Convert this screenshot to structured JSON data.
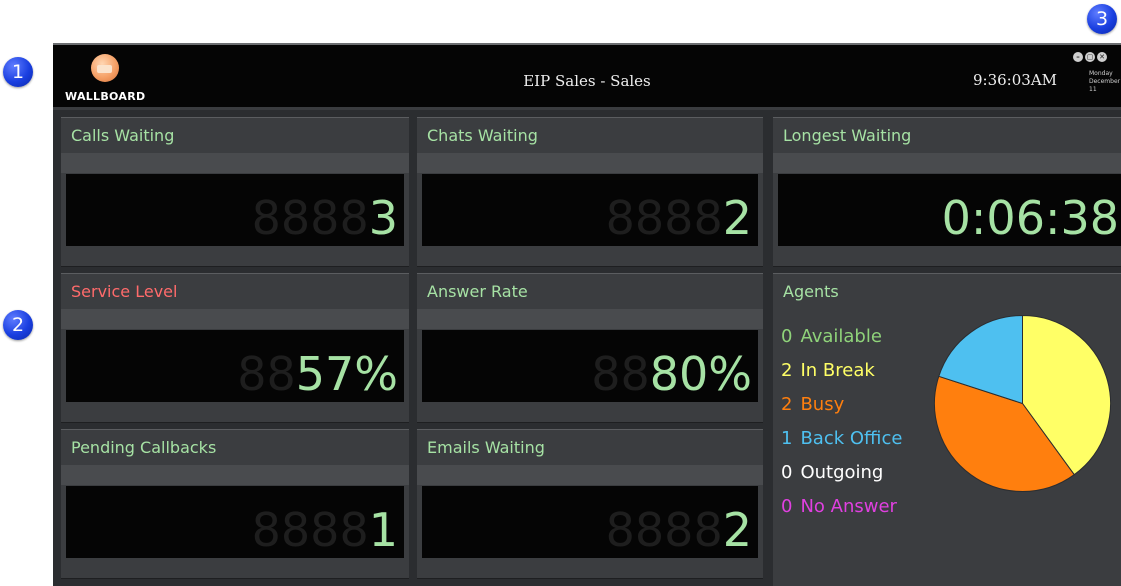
{
  "callouts": [
    "1",
    "2",
    "3"
  ],
  "header": {
    "logo_text": "WALLBOARD",
    "title": "EIP Sales - Sales",
    "time": "9:36:03AM",
    "day": "Monday",
    "date": "December 11",
    "window_controls": [
      "–",
      "▢",
      "✕"
    ]
  },
  "tiles": [
    {
      "id": "calls-waiting",
      "title": "Calls Waiting",
      "ghost": "8888",
      "value": "3"
    },
    {
      "id": "chats-waiting",
      "title": "Chats Waiting",
      "ghost": "8888",
      "value": "2"
    },
    {
      "id": "longest-waiting",
      "title": "Longest Waiting",
      "ghost": "",
      "value": "0:06:38"
    },
    {
      "id": "service-level",
      "title": "Service Level",
      "ghost": "88",
      "value": "57%"
    },
    {
      "id": "answer-rate",
      "title": "Answer Rate",
      "ghost": "88",
      "value": "80%"
    },
    {
      "id": "pending-callbacks",
      "title": "Pending Callbacks",
      "ghost": "8888",
      "value": "1"
    },
    {
      "id": "emails-waiting",
      "title": "Emails Waiting",
      "ghost": "8888",
      "value": "2"
    }
  ],
  "agents": {
    "title": "Agents",
    "rows": [
      {
        "count": "0",
        "label": "Available",
        "color": "#8fd37a"
      },
      {
        "count": "2",
        "label": "In Break",
        "color": "#ffff66"
      },
      {
        "count": "2",
        "label": "Busy",
        "color": "#ff7f0e"
      },
      {
        "count": "1",
        "label": "Back Office",
        "color": "#4ec0f0"
      },
      {
        "count": "0",
        "label": "Outgoing",
        "color": "#ffffff"
      },
      {
        "count": "0",
        "label": "No Answer",
        "color": "#e040e0"
      }
    ]
  },
  "colors": {
    "value_green": "#a6e2a4",
    "title_alert": "#ff6b6b",
    "background": "#2b2d30"
  }
}
